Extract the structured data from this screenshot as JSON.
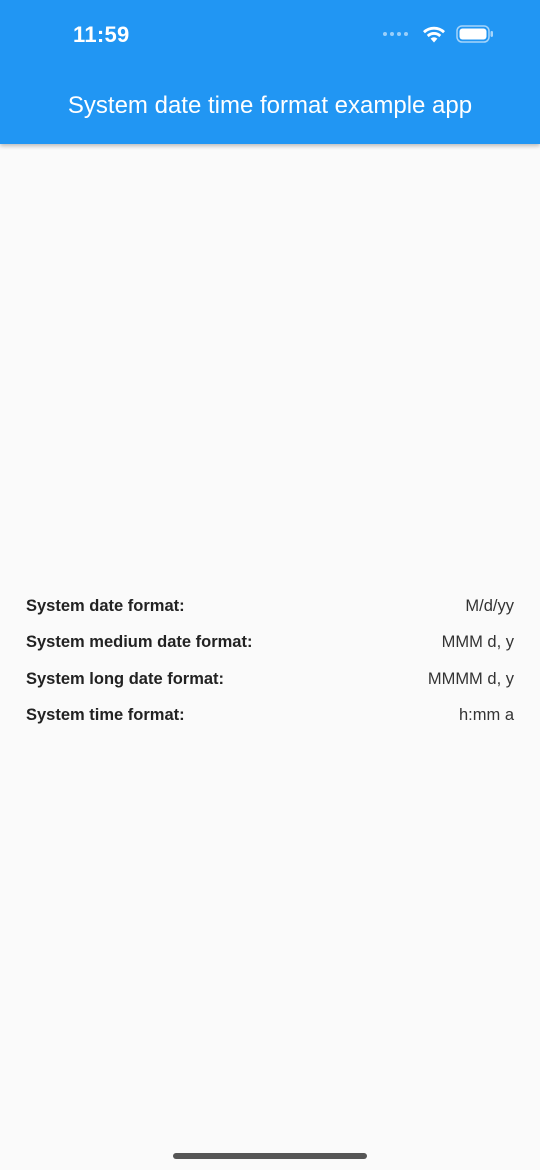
{
  "status_bar": {
    "time": "11:59",
    "icons": [
      "signal-dots-icon",
      "wifi-icon",
      "battery-icon"
    ]
  },
  "app_bar": {
    "title": "System date time format example app",
    "color": "#2196f3"
  },
  "formats": [
    {
      "label": "System date format:",
      "value": "M/d/yy"
    },
    {
      "label": "System medium date format:",
      "value": "MMM d, y"
    },
    {
      "label": "System long date format:",
      "value": "MMMM d, y"
    },
    {
      "label": "System time format:",
      "value": "h:mm a"
    }
  ]
}
